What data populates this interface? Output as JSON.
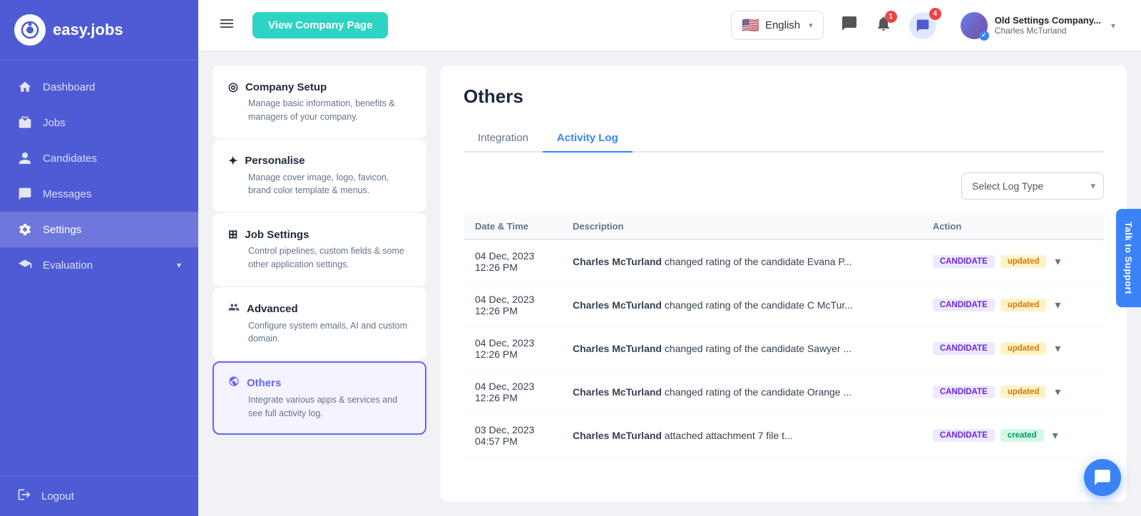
{
  "sidebar": {
    "logo_text": "easy.jobs",
    "items": [
      {
        "id": "dashboard",
        "label": "Dashboard",
        "icon": "⌂"
      },
      {
        "id": "jobs",
        "label": "Jobs",
        "icon": "💼"
      },
      {
        "id": "candidates",
        "label": "Candidates",
        "icon": "👤"
      },
      {
        "id": "messages",
        "label": "Messages",
        "icon": "💬"
      },
      {
        "id": "settings",
        "label": "Settings",
        "icon": "⚙",
        "active": true
      },
      {
        "id": "evaluation",
        "label": "Evaluation",
        "icon": "🎓",
        "has_chevron": true
      }
    ],
    "logout_label": "Logout"
  },
  "header": {
    "view_company_label": "View Company Page",
    "lang": "English",
    "msg_badge": "",
    "bell_badge": "1",
    "chat_badge": "4",
    "user_company": "Old Settings Company...",
    "user_name": "Charles McTurland"
  },
  "settings_menu": [
    {
      "id": "company-setup",
      "title": "Company Setup",
      "icon": "◎",
      "desc": "Manage basic information, benefits & managers of your company.",
      "active": false
    },
    {
      "id": "personalise",
      "title": "Personalise",
      "icon": "✦",
      "desc": "Manage cover image, logo, favicon, brand color template & menus.",
      "active": false
    },
    {
      "id": "job-settings",
      "title": "Job Settings",
      "icon": "⊞",
      "desc": "Control pipelines, custom fields & some other application settings.",
      "active": false
    },
    {
      "id": "advanced",
      "title": "Advanced",
      "icon": "👥",
      "desc": "Configure system emails, AI and custom domain.",
      "active": false
    },
    {
      "id": "others",
      "title": "Others",
      "icon": "✦",
      "desc": "Integrate various apps & services and see full activity log.",
      "active": true
    }
  ],
  "main": {
    "page_title": "Others",
    "tabs": [
      {
        "id": "integration",
        "label": "Integration",
        "active": false
      },
      {
        "id": "activity-log",
        "label": "Activity Log",
        "active": true
      }
    ],
    "select_placeholder": "Select Log Type",
    "table": {
      "columns": [
        "Date & Time",
        "Description",
        "Action"
      ],
      "rows": [
        {
          "date": "04 Dec, 2023",
          "time": "12:26 PM",
          "desc_actor": "Charles McTurland",
          "desc_action": " changed rating of the candidate Evana P...",
          "badge_type": "CANDIDATE",
          "badge_status": "updated"
        },
        {
          "date": "04 Dec, 2023",
          "time": "12:26 PM",
          "desc_actor": "Charles McTurland",
          "desc_action": " changed rating of the candidate C McTur...",
          "badge_type": "CANDIDATE",
          "badge_status": "updated"
        },
        {
          "date": "04 Dec, 2023",
          "time": "12:26 PM",
          "desc_actor": "Charles McTurland",
          "desc_action": " changed rating of the candidate Sawyer ...",
          "badge_type": "CANDIDATE",
          "badge_status": "updated"
        },
        {
          "date": "04 Dec, 2023",
          "time": "12:26 PM",
          "desc_actor": "Charles McTurland",
          "desc_action": " changed rating of the candidate Orange ...",
          "badge_type": "CANDIDATE",
          "badge_status": "updated"
        },
        {
          "date": "03 Dec, 2023",
          "time": "04:57 PM",
          "desc_actor": "Charles McTurland",
          "desc_action": " attached attachment 7 file t...",
          "badge_type": "CANDIDATE",
          "badge_status": "created"
        }
      ]
    }
  },
  "support_tab_label": "Talk to Support",
  "chat_icon": "💬"
}
